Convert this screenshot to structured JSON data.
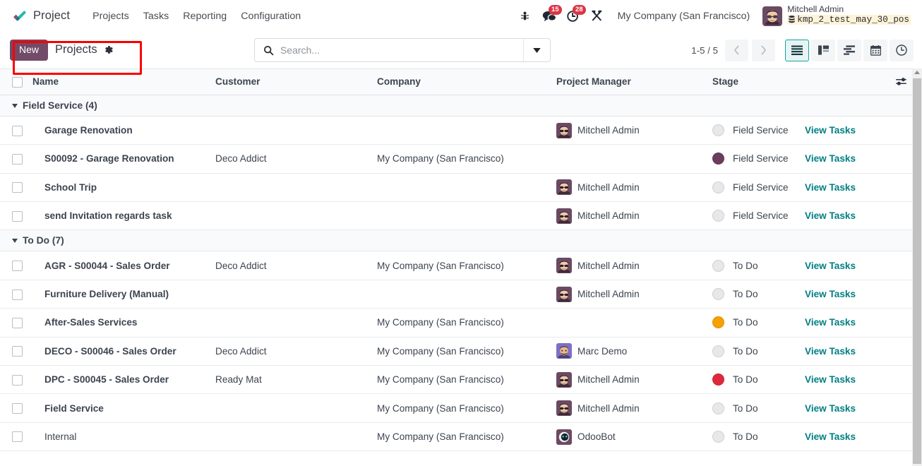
{
  "navbar": {
    "brand": "Project",
    "menu": [
      "Projects",
      "Tasks",
      "Reporting",
      "Configuration"
    ],
    "bug_icon": "bug-icon",
    "messages": {
      "icon": "messages-icon",
      "count": "15"
    },
    "activities": {
      "icon": "clock-icon",
      "count": "28"
    },
    "tools_icon": "tools-icon",
    "company": "My Company (San Francisco)",
    "user": {
      "name": "Mitchell Admin",
      "database": "kmp_2_test_may_30_pos"
    }
  },
  "control_panel": {
    "new_label": "New",
    "title": "Projects",
    "gear_icon": "gear-icon",
    "search": {
      "placeholder": "Search...",
      "value": "",
      "icon": "search-icon",
      "toggle_icon": "chevron-down-icon"
    },
    "pager": {
      "value": "1-5 / 5",
      "prev_icon": "chevron-left-icon",
      "next_icon": "chevron-right-icon"
    },
    "views": [
      {
        "name": "list",
        "icon": "list-icon",
        "active": true
      },
      {
        "name": "kanban",
        "icon": "kanban-icon",
        "active": false
      },
      {
        "name": "gantt",
        "icon": "gantt-icon",
        "active": false
      },
      {
        "name": "calendar",
        "icon": "calendar-icon",
        "active": false
      },
      {
        "name": "activity",
        "icon": "activity-clock-icon",
        "active": false
      }
    ]
  },
  "list": {
    "columns": {
      "name": "Name",
      "customer": "Customer",
      "company": "Company",
      "project_manager": "Project Manager",
      "stage": "Stage",
      "optional_icon": "toggle-columns-icon"
    },
    "groups": [
      {
        "label": "Field Service (4)",
        "rows": [
          {
            "name": "Garage Renovation",
            "name_bold": true,
            "customer": "",
            "company": "",
            "manager": "Mitchell Admin",
            "manager_avatar": "mitchell",
            "stage_color": "#e6e8ea",
            "stage": "Field Service",
            "action": "View Tasks"
          },
          {
            "name": "S00092 - Garage Renovation",
            "name_bold": true,
            "customer": "Deco Addict",
            "company": "My Company (San Francisco)",
            "manager": "",
            "manager_avatar": "",
            "stage_color": "#6b3d5c",
            "stage": "Field Service",
            "action": "View Tasks"
          },
          {
            "name": "School Trip",
            "name_bold": true,
            "customer": "",
            "company": "",
            "manager": "Mitchell Admin",
            "manager_avatar": "mitchell",
            "stage_color": "#e6e8ea",
            "stage": "Field Service",
            "action": "View Tasks"
          },
          {
            "name": "send Invitation regards task",
            "name_bold": true,
            "customer": "",
            "company": "",
            "manager": "Mitchell Admin",
            "manager_avatar": "mitchell",
            "stage_color": "#e6e8ea",
            "stage": "Field Service",
            "action": "View Tasks"
          }
        ]
      },
      {
        "label": "To Do (7)",
        "rows": [
          {
            "name": "AGR - S00044 - Sales Order",
            "name_bold": true,
            "customer": "Deco Addict",
            "company": "My Company (San Francisco)",
            "manager": "Mitchell Admin",
            "manager_avatar": "mitchell",
            "stage_color": "#e6e8ea",
            "stage": "To Do",
            "action": "View Tasks"
          },
          {
            "name": "Furniture Delivery (Manual)",
            "name_bold": true,
            "customer": "",
            "company": "",
            "manager": "Mitchell Admin",
            "manager_avatar": "mitchell",
            "stage_color": "#e6e8ea",
            "stage": "To Do",
            "action": "View Tasks"
          },
          {
            "name": "After-Sales Services",
            "name_bold": true,
            "customer": "",
            "company": "My Company (San Francisco)",
            "manager": "",
            "manager_avatar": "",
            "stage_color": "#f5a100",
            "stage": "To Do",
            "action": "View Tasks"
          },
          {
            "name": "DECO - S00046 - Sales Order",
            "name_bold": true,
            "customer": "Deco Addict",
            "company": "My Company (San Francisco)",
            "manager": "Marc Demo",
            "manager_avatar": "marc",
            "stage_color": "#e6e8ea",
            "stage": "To Do",
            "action": "View Tasks"
          },
          {
            "name": "DPC - S00045 - Sales Order",
            "name_bold": true,
            "customer": "Ready Mat",
            "company": "My Company (San Francisco)",
            "manager": "Mitchell Admin",
            "manager_avatar": "mitchell",
            "stage_color": "#e0283c",
            "stage": "To Do",
            "action": "View Tasks"
          },
          {
            "name": "Field Service",
            "name_bold": true,
            "customer": "",
            "company": "My Company (San Francisco)",
            "manager": "Mitchell Admin",
            "manager_avatar": "mitchell",
            "stage_color": "#e6e8ea",
            "stage": "To Do",
            "action": "View Tasks"
          },
          {
            "name": "Internal",
            "name_bold": false,
            "customer": "",
            "company": "My Company (San Francisco)",
            "manager": "OdooBot",
            "manager_avatar": "odoobot",
            "stage_color": "#e6e8ea",
            "stage": "To Do",
            "action": "View Tasks"
          }
        ]
      }
    ]
  },
  "annotation": {
    "color": "#fc0000",
    "target": "new-button-and-title"
  },
  "theme": {
    "primary": "#714b67",
    "link": "#017e84",
    "accent_active": "#17a2a2",
    "badge": "#dc3545"
  }
}
